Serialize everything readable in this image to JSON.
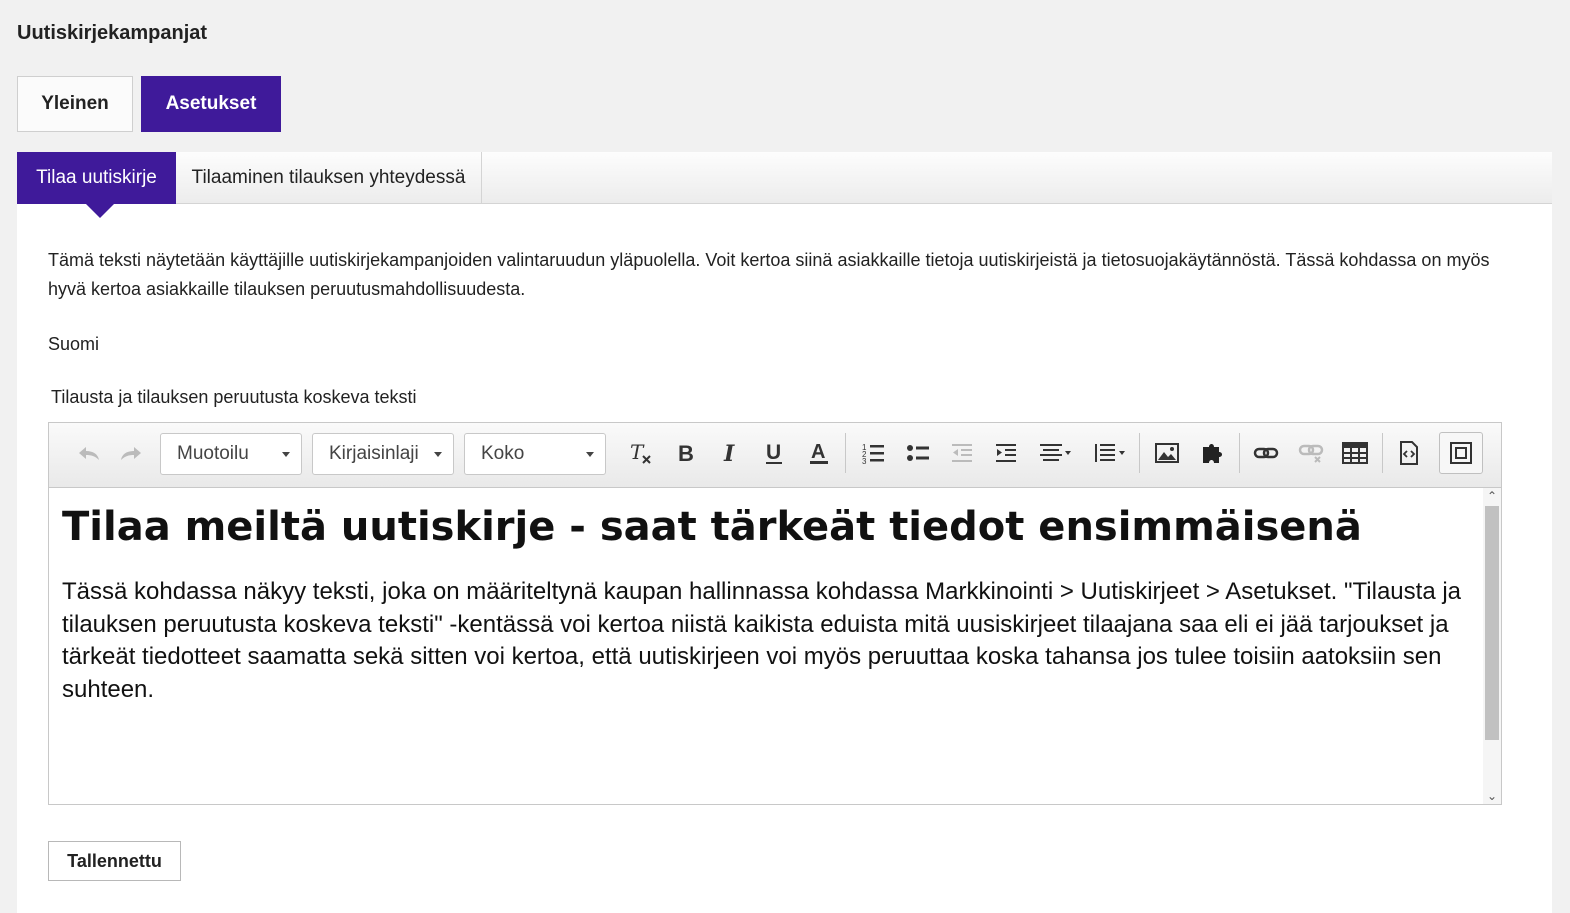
{
  "header": {
    "title": "Uutiskirjekampanjat"
  },
  "main_tabs": [
    {
      "label": "Yleinen",
      "active": false
    },
    {
      "label": "Asetukset",
      "active": true
    }
  ],
  "sub_tabs": [
    {
      "label": "Tilaa uutiskirje",
      "active": true
    },
    {
      "label": "Tilaaminen tilauksen yhteydessä",
      "active": false
    }
  ],
  "description": "Tämä teksti näytetään käyttäjille uutiskirjekampanjoiden valintaruudun yläpuolella. Voit kertoa siinä asiakkaille tietoja uutiskirjeistä ja tietosuojakäytännöstä. Tässä kohdassa on myös hyvä kertoa asiakkaille tilauksen peruutusmahdollisuudesta.",
  "language": "Suomi",
  "field_label": "Tilausta ja tilauksen peruutusta koskeva teksti",
  "editor": {
    "toolbar": {
      "format_combo": "Muotoilu",
      "font_combo": "Kirjaisinlaji",
      "size_combo": "Koko"
    },
    "heading": "Tilaa meiltä uutiskirje - saat tärkeät tiedot ensimmäisenä",
    "body": "Tässä kohdassa näkyy teksti, joka on määriteltynä kaupan hallinnassa kohdassa Markkinointi > Uutiskirjeet > Asetukset. \"Tilausta ja tilauksen peruutusta koskeva teksti\" -kentässä voi kertoa niistä kaikista eduista mitä uusiskirjeet tilaajana saa eli ei jää tarjoukset ja tärkeät tiedotteet saamatta sekä sitten voi kertoa, että uutiskirjeen voi myös peruuttaa koska tahansa jos tulee toisiin aatoksiin sen suhteen."
  },
  "save_button": "Tallennettu",
  "colors": {
    "accent": "#3f1a9a"
  }
}
